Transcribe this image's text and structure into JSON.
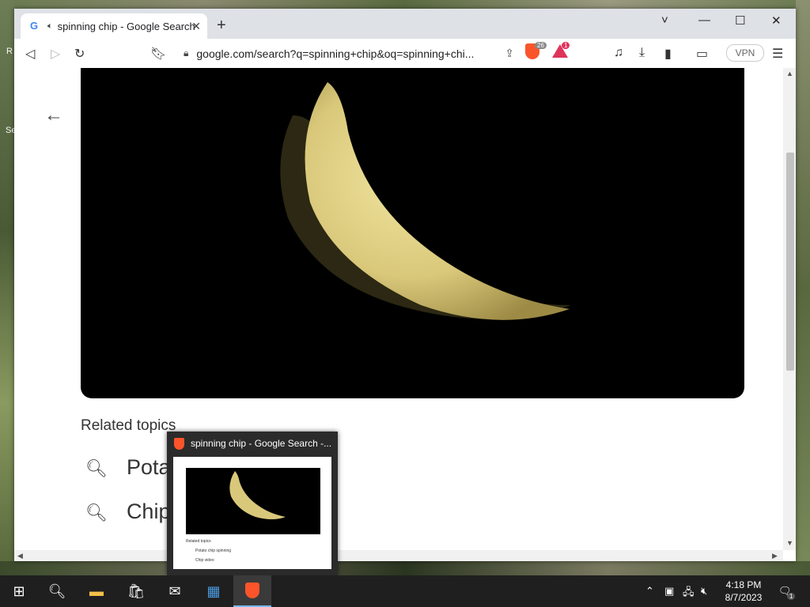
{
  "browser": {
    "tab": {
      "title": "spinning chip - Google Search",
      "favicon": "google-g-icon",
      "audio": "speaker-icon"
    },
    "new_tab": "+",
    "window_controls": {
      "dropdown": "˅",
      "minimize": "—",
      "maximize": "☐",
      "close": "✕"
    },
    "url": "google.com/search?q=spinning+chip&oq=spinning+chi...",
    "shields_count": "26",
    "rewards_count": "1",
    "vpn_label": "VPN"
  },
  "page": {
    "related_topics_heading": "Related topics",
    "related_items": [
      "Potato chip spinning",
      "Chip video"
    ],
    "related_items_visible": [
      "Potat",
      "Chip"
    ]
  },
  "preview": {
    "title": "spinning chip - Google Search -...",
    "thumb_related_heading": "Related topics",
    "thumb_items": [
      "Potato chip spinning",
      "Chip video"
    ]
  },
  "taskbar": {
    "time": "4:18 PM",
    "date": "8/7/2023",
    "notification_count": "1"
  },
  "desktop_fragments": [
    "R",
    "Se"
  ],
  "colors": {
    "brave": "#fb542b",
    "chip": "#e8d88a",
    "taskbar": "#1f1f1f"
  }
}
